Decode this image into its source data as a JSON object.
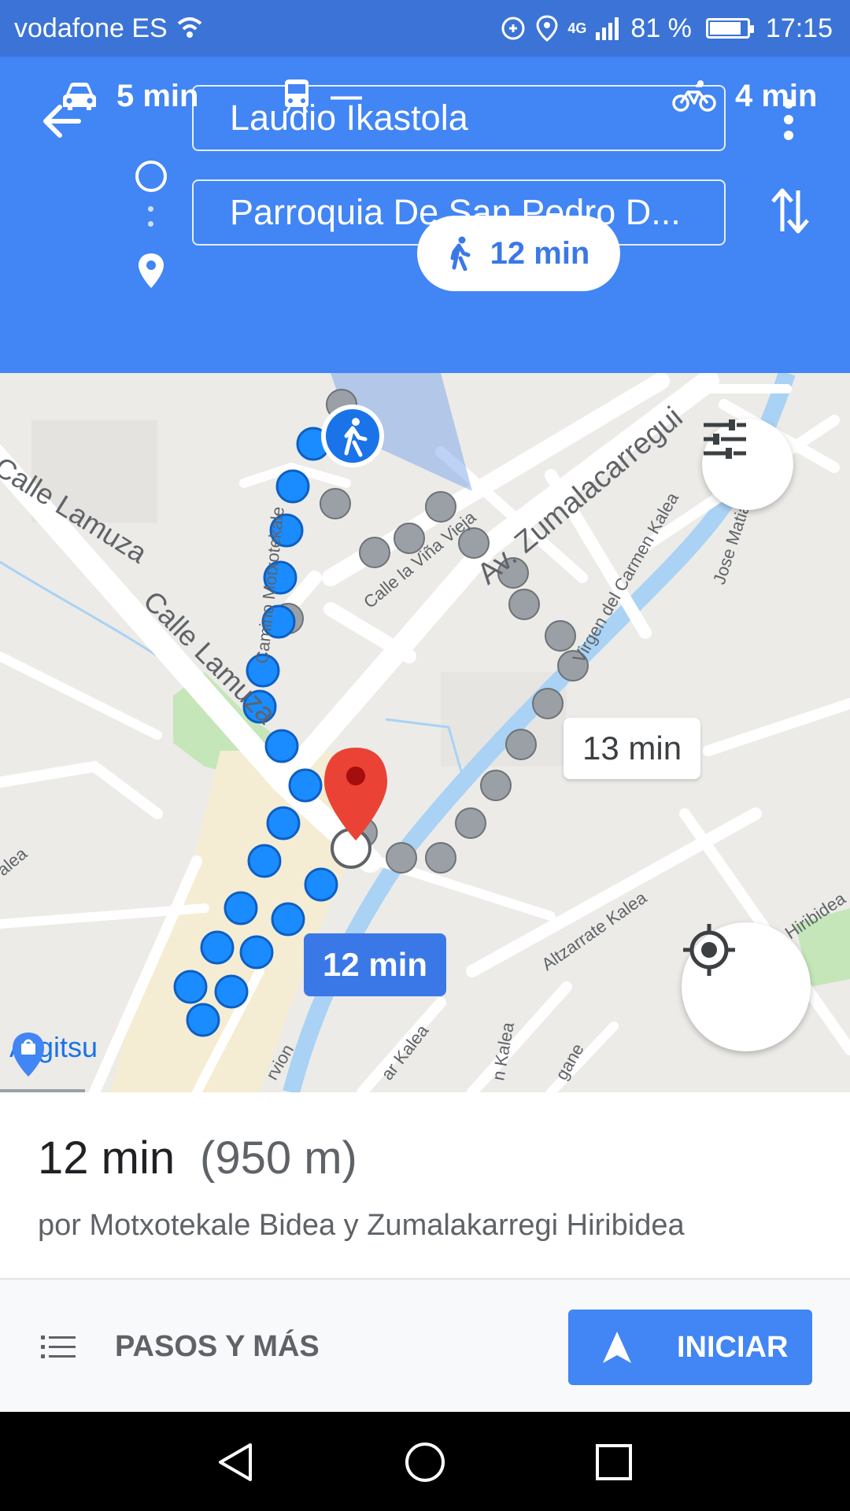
{
  "status_bar": {
    "carrier": "vodafone ES",
    "network": "4G",
    "battery": "81 %",
    "time": "17:15",
    "icons": [
      "wifi-icon",
      "data-saver-icon",
      "location-icon",
      "signal-icon",
      "battery-icon"
    ]
  },
  "header": {
    "origin": "Laudio Ikastola",
    "destination": "Parroquia De San Pedro D...",
    "icons": [
      "arrow-back-icon",
      "origin-circle-icon",
      "destination-pin-icon",
      "more-vert-icon",
      "swap-vert-icon"
    ]
  },
  "travel_modes": [
    {
      "mode": "car",
      "label": "5 min",
      "icon": "car-icon"
    },
    {
      "mode": "transit",
      "label": "—",
      "icon": "train-icon"
    },
    {
      "mode": "walk",
      "label": "12 min",
      "icon": "walking-icon",
      "selected": true
    },
    {
      "mode": "bike",
      "label": "4 min",
      "icon": "bicycle-icon"
    }
  ],
  "map": {
    "streets": [
      "Calle Lamuza",
      "Calle Lamuza",
      "Camino Motxotekale",
      "Calle la Viña Vieja",
      "Av. Zumalacarregui",
      "Virgen del Carmen Kalea",
      "Jose Matia",
      "Altzarrate Kalea",
      "Hiribidea",
      "alea",
      "rvion",
      "ar Kalea",
      "n Kalea",
      "gane"
    ],
    "poi": "Argitsu",
    "main_route_time": "12 min",
    "alt_route_time": "13 min",
    "colors": {
      "main_route": "#1a8cff",
      "alt_route": "#9aa0a6",
      "pin": "#ea4335",
      "park": "#c5e6b9",
      "water": "#a9d2f5"
    }
  },
  "summary": {
    "time": "12 min",
    "distance": "(950 m)",
    "via": "por Motxotekale Bidea y Zumalakarregi Hiribidea"
  },
  "actions": {
    "steps_label": "PASOS Y MÁS",
    "start_label": "INICIAR"
  }
}
